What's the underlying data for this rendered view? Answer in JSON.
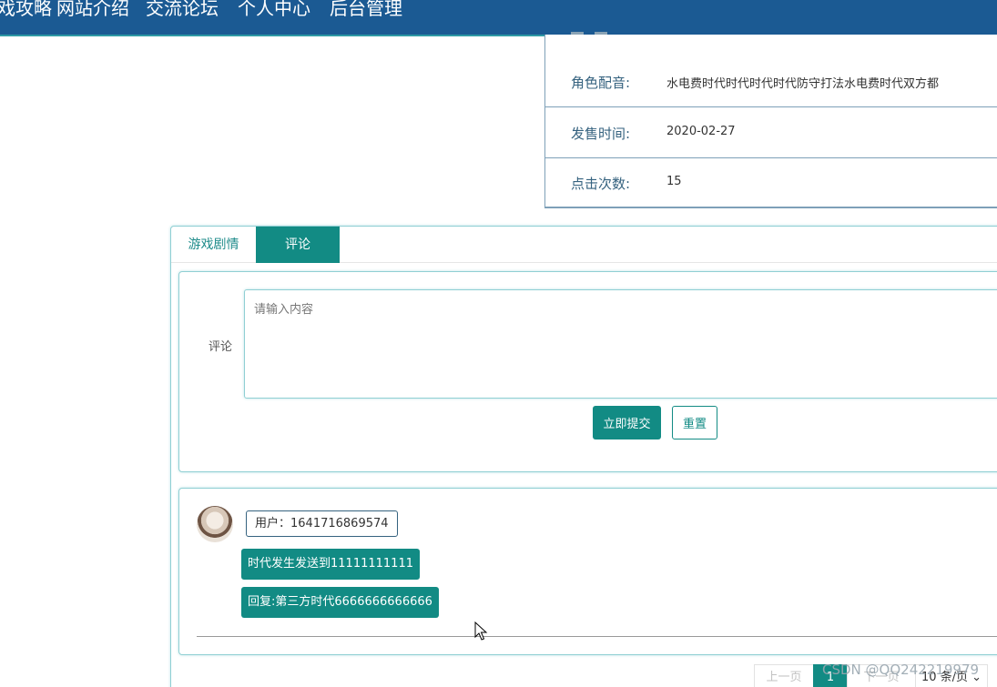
{
  "nav": {
    "items": [
      "戏攻略",
      "网站介绍",
      "交流论坛",
      "个人中心",
      "后台管理"
    ]
  },
  "details": {
    "rows": [
      {
        "label": "角色配音:",
        "value": "水电费时代时代时代时代防守打法水电费时代双方都"
      },
      {
        "label": "发售时间:",
        "value": "2020-02-27"
      },
      {
        "label": "点击次数:",
        "value": "15"
      }
    ]
  },
  "tabs": {
    "story": "游戏剧情",
    "comments": "评论"
  },
  "comment_form": {
    "label": "评论",
    "placeholder": "请输入内容",
    "submit": "立即提交",
    "reset": "重置"
  },
  "comments": [
    {
      "user": "用户：1641716869574",
      "content": "时代发生发送到11111111111",
      "reply": "回复:第三方时代6666666666666"
    }
  ],
  "pagination": {
    "prev": "上一页",
    "current": "1",
    "next": "下一页",
    "page_size": "10 条/页"
  },
  "watermark": "CSDN @QQ242219979",
  "colors": {
    "nav_bg": "#1b5a93",
    "accent": "#128b84",
    "label_text": "#35627f"
  }
}
